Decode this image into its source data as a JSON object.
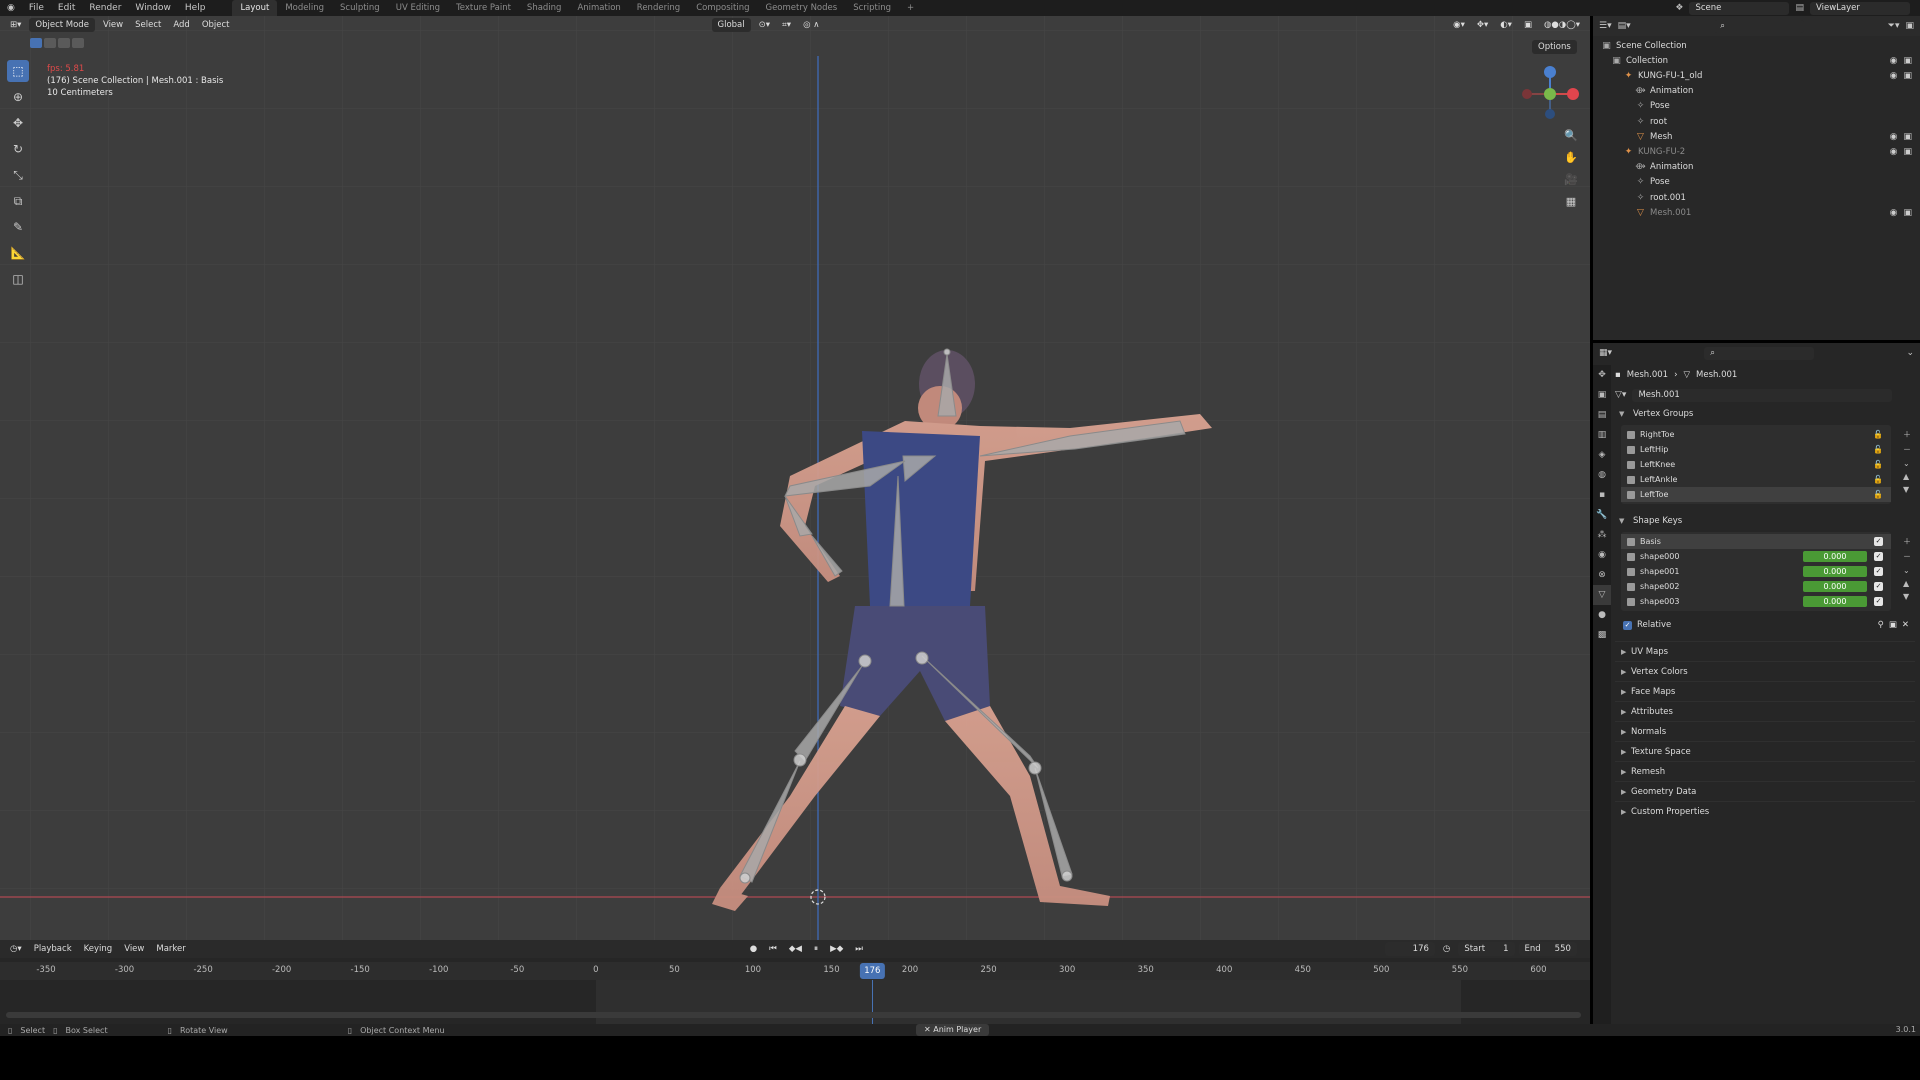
{
  "topbar": {
    "menus": [
      "File",
      "Edit",
      "Render",
      "Window",
      "Help"
    ],
    "workspaces": [
      "Layout",
      "Modeling",
      "Sculpting",
      "UV Editing",
      "Texture Paint",
      "Shading",
      "Animation",
      "Rendering",
      "Compositing",
      "Geometry Nodes",
      "Scripting"
    ],
    "active_workspace": "Layout",
    "add_tab": "+",
    "scene": "Scene",
    "view_layer": "ViewLayer"
  },
  "viewport": {
    "mode": "Object Mode",
    "menus": [
      "View",
      "Select",
      "Add",
      "Object"
    ],
    "orientation": "Global",
    "options": "Options",
    "info": {
      "fps": "fps: 5.81",
      "context": "(176) Scene Collection | Mesh.001 : Basis",
      "scale": "10 Centimeters"
    },
    "gizmo": {
      "x": "X",
      "y": "Y",
      "z": "Z"
    }
  },
  "timeline": {
    "menus": [
      "Playback",
      "Keying",
      "View",
      "Marker"
    ],
    "current_frame": "176",
    "start_label": "Start",
    "start": "1",
    "end_label": "End",
    "end": "550",
    "ticks": [
      "-350",
      "-300",
      "-250",
      "-200",
      "-150",
      "-100",
      "-50",
      "0",
      "50",
      "100",
      "150",
      "200",
      "250",
      "300",
      "350",
      "400",
      "450",
      "500",
      "550",
      "600"
    ]
  },
  "statusbar": {
    "select": "Select",
    "box_select": "Box Select",
    "rotate_view": "Rotate View",
    "context_menu": "Object Context Menu",
    "anim_player": "Anim Player",
    "version": "3.0.1"
  },
  "outliner": {
    "rows": [
      {
        "label": "Scene Collection",
        "icon": "scene-collection-icon"
      },
      {
        "label": "Collection",
        "icon": "collection-icon"
      },
      {
        "label": "KUNG-FU-1_old",
        "icon": "armature-icon"
      },
      {
        "label": "Animation",
        "icon": "animation-icon"
      },
      {
        "label": "Pose",
        "icon": "pose-icon"
      },
      {
        "label": "root",
        "icon": "bone-icon"
      },
      {
        "label": "Mesh",
        "icon": "mesh-icon"
      },
      {
        "label": "KUNG-FU-2",
        "icon": "armature-icon"
      },
      {
        "label": "Animation",
        "icon": "animation-icon"
      },
      {
        "label": "Pose",
        "icon": "pose-icon"
      },
      {
        "label": "root.001",
        "icon": "bone-icon"
      },
      {
        "label": "Mesh.001",
        "icon": "mesh-icon"
      }
    ]
  },
  "properties": {
    "breadcrumb_object": "Mesh.001",
    "breadcrumb_data": "Mesh.001",
    "datablock_name": "Mesh.001",
    "vertex_groups_title": "Vertex Groups",
    "vertex_groups": [
      "RightToe",
      "LeftHip",
      "LeftKnee",
      "LeftAnkle",
      "LeftToe"
    ],
    "shape_keys_title": "Shape Keys",
    "shape_keys": [
      {
        "name": "Basis",
        "value": ""
      },
      {
        "name": "shape000",
        "value": "0.000"
      },
      {
        "name": "shape001",
        "value": "0.000"
      },
      {
        "name": "shape002",
        "value": "0.000"
      },
      {
        "name": "shape003",
        "value": "0.000"
      }
    ],
    "relative_label": "Relative",
    "collapsed_panels": [
      "UV Maps",
      "Vertex Colors",
      "Face Maps",
      "Attributes",
      "Normals",
      "Texture Space",
      "Remesh",
      "Geometry Data",
      "Custom Properties"
    ]
  }
}
